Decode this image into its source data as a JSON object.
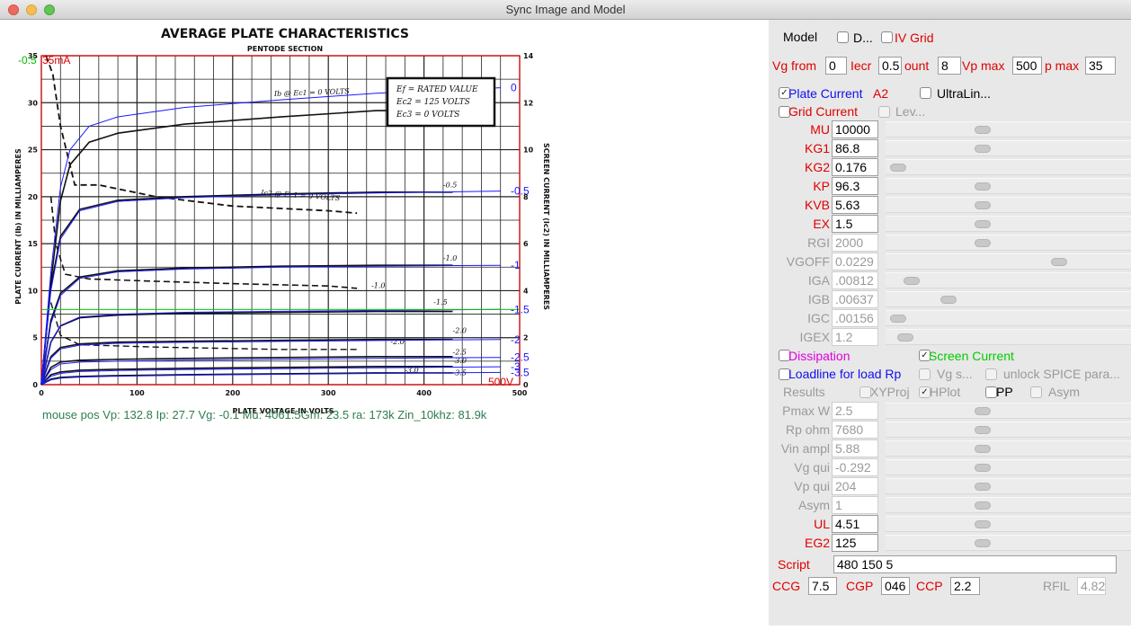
{
  "window": {
    "title": "Sync Image and Model"
  },
  "chart": {
    "title": "AVERAGE PLATE CHARACTERISTICS",
    "subtitle": "PENTODE SECTION",
    "xlabel": "PLATE VOLTAGE IN VOLTS",
    "ylabel_left": "PLATE CURRENT (Ib) IN MILLIAMPERES",
    "ylabel_right": "SCREEN CURRENT (Ic2) IN MILLIAMPERES",
    "legend_box": [
      "Ef = RATED VALUE",
      "Ec2 = 125 VOLTS",
      "Ec3 = 0 VOLTS"
    ],
    "annot_ib": "Ib @ Ec1 = 0 VOLTS",
    "annot_ic2": "Ic2 @ Ec1 = 0 VOLTS",
    "overlay_current": "35mA",
    "overlay_value": "-0.5",
    "overlay_voltage": "500V",
    "curve_labels_image": [
      "-0.5",
      "-1.0",
      "-1.0",
      "-1.5",
      "-2.0",
      "-2.0",
      "-2.5",
      "-3.0",
      "-3.0",
      "-3.5"
    ],
    "model_labels": [
      "0",
      "-0.5",
      "-1",
      "-1.5",
      "-2",
      "-2.5",
      "-3",
      "-3.5"
    ],
    "status_line": "mouse pos Vp: 132.8  Ip: 27.7    Vg: -0.1    Mu: 4061.5Gm: 23.5   ra: 173k   Zin_10khz: 81.9k"
  },
  "chart_data": {
    "type": "line",
    "title": "AVERAGE PLATE CHARACTERISTICS",
    "subtitle": "PENTODE SECTION",
    "xlabel": "PLATE VOLTAGE IN VOLTS",
    "ylabel": "PLATE CURRENT (Ib) IN MILLIAMPERES",
    "y2label": "SCREEN CURRENT (Ic2) IN MILLIAMPERES",
    "xlim": [
      0,
      500
    ],
    "ylim": [
      0,
      35
    ],
    "y2lim": [
      0,
      14
    ],
    "xticks": [
      0,
      100,
      200,
      300,
      400,
      500
    ],
    "yticks": [
      0,
      5,
      10,
      15,
      20,
      25,
      30,
      35
    ],
    "y2ticks": [
      0,
      2,
      4,
      6,
      8,
      10,
      12,
      14
    ],
    "grid": true,
    "series": [
      {
        "name": "0",
        "x": [
          0,
          10,
          20,
          30,
          50,
          80,
          150,
          250,
          350,
          480
        ],
        "y": [
          0,
          12,
          21,
          25,
          27.5,
          28.5,
          29.5,
          30.3,
          31,
          31.6
        ]
      },
      {
        "name": "-0.5",
        "x": [
          0,
          10,
          20,
          40,
          80,
          150,
          250,
          350,
          480
        ],
        "y": [
          0,
          10,
          15.5,
          18.5,
          19.5,
          19.9,
          20.2,
          20.4,
          20.6
        ]
      },
      {
        "name": "-1",
        "x": [
          0,
          10,
          20,
          40,
          80,
          150,
          250,
          350,
          480
        ],
        "y": [
          0,
          6.5,
          9.5,
          11.3,
          12,
          12.3,
          12.5,
          12.6,
          12.7
        ]
      },
      {
        "name": "-1.5",
        "x": [
          0,
          10,
          20,
          40,
          80,
          150,
          250,
          350,
          480
        ],
        "y": [
          0,
          4.5,
          6.3,
          7.2,
          7.5,
          7.7,
          7.8,
          7.9,
          8
        ]
      },
      {
        "name": "-2",
        "x": [
          0,
          10,
          20,
          40,
          80,
          150,
          250,
          350,
          480
        ],
        "y": [
          0,
          2.8,
          3.8,
          4.2,
          4.4,
          4.5,
          4.6,
          4.7,
          4.8
        ]
      },
      {
        "name": "-2.5",
        "x": [
          0,
          10,
          20,
          40,
          80,
          150,
          250,
          350,
          480
        ],
        "y": [
          0,
          1.6,
          2.2,
          2.4,
          2.5,
          2.6,
          2.7,
          2.8,
          2.9
        ]
      },
      {
        "name": "-3",
        "x": [
          0,
          10,
          20,
          40,
          80,
          150,
          250,
          350,
          480
        ],
        "y": [
          0,
          0.9,
          1.2,
          1.4,
          1.5,
          1.6,
          1.7,
          1.8,
          1.9
        ]
      },
      {
        "name": "-3.5",
        "x": [
          0,
          10,
          20,
          40,
          80,
          150,
          250,
          350,
          480
        ],
        "y": [
          0,
          0.5,
          0.7,
          0.8,
          0.9,
          1.0,
          1.1,
          1.2,
          1.3
        ]
      }
    ],
    "hline": 8.0
  },
  "colors": {
    "model_curve": "#1a1aff",
    "red": "#e00000",
    "green": "#00cc00",
    "status": "#2e7d4f",
    "panel": "#e8e8e8"
  },
  "panel": {
    "model_label": "Model",
    "d_label": "D...",
    "ivgrid_label": "IV Grid",
    "vg_from_label": "Vg from",
    "vg_from": "0",
    "iecr_label": "Iecr",
    "iecr": "0.5",
    "count_label": "ount",
    "count": "8",
    "vpmax_label": "Vp max",
    "vpmax": "500",
    "pmax_label": "p max",
    "pmax": "35",
    "plate_current_label": "Plate Current",
    "a2_label": "A2",
    "ultralin_label": "UltraLin...",
    "grid_current_label": "Grid Current",
    "lev_label": "Lev...",
    "params": [
      {
        "name": "MU",
        "value": "10000",
        "enabled": true,
        "knob": 0.39
      },
      {
        "name": "KG1",
        "value": "86.8",
        "enabled": true,
        "knob": 0.39
      },
      {
        "name": "KG2",
        "value": "0.176",
        "enabled": true,
        "knob": 0.02
      },
      {
        "name": "KP",
        "value": "96.3",
        "enabled": true,
        "knob": 0.39
      },
      {
        "name": "KVB",
        "value": "5.63",
        "enabled": true,
        "knob": 0.39
      },
      {
        "name": "EX",
        "value": "1.5",
        "enabled": true,
        "knob": 0.39
      },
      {
        "name": "RGI",
        "value": "2000",
        "enabled": false,
        "knob": 0.39
      },
      {
        "name": "VGOFF",
        "value": "0.0229",
        "enabled": false,
        "knob": 0.72
      },
      {
        "name": "IGA",
        "value": ".00812",
        "enabled": false,
        "knob": 0.08
      },
      {
        "name": "IGB",
        "value": ".00637",
        "enabled": false,
        "knob": 0.24
      },
      {
        "name": "IGC",
        "value": ".00156",
        "enabled": false,
        "knob": 0.02
      },
      {
        "name": "IGEX",
        "value": "1.2",
        "enabled": false,
        "knob": 0.05
      }
    ],
    "dissipation_label": "Dissipation",
    "screen_current_label": "Screen Current",
    "loadline_label": "Loadline for load Rp",
    "vgs_label": "Vg s...",
    "unlock_label": "unlock SPICE para...",
    "results_label": "Results",
    "xyproj_label": "XYProj",
    "hplot_label": "HPlot",
    "pp_label": "PP",
    "asym_label": "Asym",
    "params2": [
      {
        "name": "Pmax W",
        "value": "2.5",
        "enabled": false,
        "knob": 0.39
      },
      {
        "name": "Rp ohm",
        "value": "7680",
        "enabled": false,
        "knob": 0.39
      },
      {
        "name": "Vin ampl",
        "value": "5.88",
        "enabled": false,
        "knob": 0.39
      },
      {
        "name": "Vg qui",
        "value": "-0.292",
        "enabled": false,
        "knob": 0.39
      },
      {
        "name": "Vp qui",
        "value": "204",
        "enabled": false,
        "knob": 0.39
      },
      {
        "name": "Asym",
        "value": "1",
        "enabled": false,
        "knob": 0.39
      },
      {
        "name": "UL",
        "value": "4.51",
        "enabled": true,
        "knob": 0.39
      },
      {
        "name": "EG2",
        "value": "125",
        "enabled": true,
        "knob": 0.39
      }
    ],
    "script_label": "Script",
    "script_value": "480 150 5",
    "ccg_label": "CCG",
    "ccg": "7.5",
    "cgp_label": "CGP",
    "cgp": "046",
    "ccp_label": "CCP",
    "ccp": "2.2",
    "rfil_label": "RFIL",
    "rfil": "4.82"
  }
}
